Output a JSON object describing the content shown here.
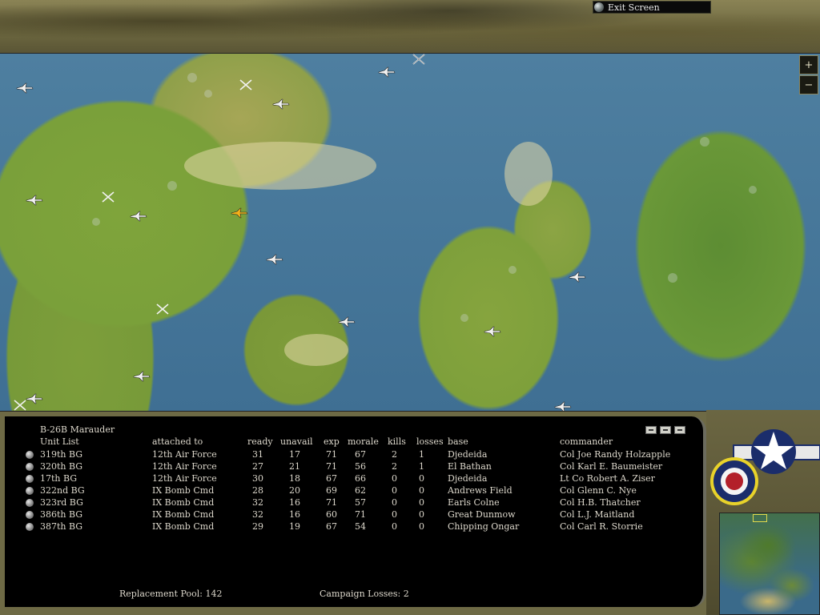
{
  "header": {
    "exit_label": "Exit Screen"
  },
  "map": {
    "zoom_in": "+",
    "zoom_out": "−"
  },
  "panel": {
    "aircraft": "B-26B Marauder",
    "columns": [
      "Unit List",
      "attached to",
      "ready",
      "unavail",
      "exp",
      "morale",
      "kills",
      "losses",
      "base",
      "commander"
    ],
    "rows": [
      {
        "unit": "319th BG",
        "attached": "12th Air Force",
        "ready": "31",
        "unavail": "17",
        "exp": "71",
        "morale": "67",
        "kills": "2",
        "losses": "1",
        "base": "Djedeida",
        "commander": "Col Joe Randy Holzapple"
      },
      {
        "unit": "320th BG",
        "attached": "12th Air Force",
        "ready": "27",
        "unavail": "21",
        "exp": "71",
        "morale": "56",
        "kills": "2",
        "losses": "1",
        "base": "El Bathan",
        "commander": "Col Karl E. Baumeister"
      },
      {
        "unit": "17th BG",
        "attached": "12th Air Force",
        "ready": "30",
        "unavail": "18",
        "exp": "67",
        "morale": "66",
        "kills": "0",
        "losses": "0",
        "base": "Djedeida",
        "commander": "Lt Co Robert A. Ziser"
      },
      {
        "unit": "322nd BG",
        "attached": "IX Bomb Cmd",
        "ready": "28",
        "unavail": "20",
        "exp": "69",
        "morale": "62",
        "kills": "0",
        "losses": "0",
        "base": "Andrews Field",
        "commander": "Col Glenn C. Nye"
      },
      {
        "unit": "323rd BG",
        "attached": "IX Bomb Cmd",
        "ready": "32",
        "unavail": "16",
        "exp": "71",
        "morale": "57",
        "kills": "0",
        "losses": "0",
        "base": "Earls Colne",
        "commander": "Col H.B. Thatcher"
      },
      {
        "unit": "386th BG",
        "attached": "IX Bomb Cmd",
        "ready": "32",
        "unavail": "16",
        "exp": "60",
        "morale": "71",
        "kills": "0",
        "losses": "0",
        "base": "Great Dunmow",
        "commander": "Col L.J. Maitland"
      },
      {
        "unit": "387th BG",
        "attached": "IX Bomb Cmd",
        "ready": "29",
        "unavail": "19",
        "exp": "67",
        "morale": "54",
        "kills": "0",
        "losses": "0",
        "base": "Chipping Ongar",
        "commander": "Col Carl R. Storrie"
      }
    ],
    "replacement_label": "Replacement Pool:",
    "replacement_value": "142",
    "campaign_losses_label": "Campaign Losses:",
    "campaign_losses_value": "2"
  },
  "colors": {
    "panel_bg": "#000000",
    "text": "#ddd8cc",
    "insignia_blue": "#1b2d6b",
    "roundel_red": "#b3202a",
    "roundel_yellow": "#e8d22a"
  },
  "icons": [
    "exit-dot-icon",
    "zoom-in-icon",
    "zoom-out-icon",
    "aircraft-unit-icon",
    "crossed-swords-icon",
    "usaaf-star-icon",
    "raf-roundel-icon"
  ]
}
